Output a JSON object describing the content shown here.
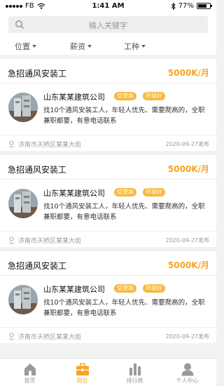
{
  "status_bar": {
    "carrier": "FB",
    "time": "1:41 AM",
    "battery": "77%",
    "battery_level": 0.77
  },
  "search": {
    "placeholder": "输入关键字"
  },
  "filters": [
    {
      "label": "位置"
    },
    {
      "label": "薪资"
    },
    {
      "label": "工种"
    }
  ],
  "jobs": [
    {
      "title": "急招通风安装工",
      "salary": "5000K/月",
      "company": "山东某某建筑公司",
      "tags": [
        "信誉高",
        "环境好"
      ],
      "description": "找10个通风安装工人，年轻人优先、需要爬高的，全职兼职都要，有意电话联系",
      "location": "济南市天桥区某某大街",
      "date": "2020-09-27发布"
    },
    {
      "title": "急招通风安装工",
      "salary": "5000K/月",
      "company": "山东某某建筑公司",
      "tags": [
        "信誉高",
        "环境好"
      ],
      "description": "找10个通风安装工人，年轻人优先、需要爬高的，全职兼职都要，有意电话联系",
      "location": "济南市天桥区某某大街",
      "date": "2020-09-27发布"
    },
    {
      "title": "急招通风安装工",
      "salary": "5000K/月",
      "company": "山东某某建筑公司",
      "tags": [
        "信誉高",
        "环境好"
      ],
      "description": "找10个通风安装工人，年轻人优先、需要爬高的，全职兼职都要，有意电话联系",
      "location": "济南市天桥区某某大街",
      "date": "2020-09-27发布"
    }
  ],
  "tabbar": [
    {
      "label": "首页",
      "icon": "home-icon",
      "active": false
    },
    {
      "label": "岗位",
      "icon": "briefcase-icon",
      "active": true
    },
    {
      "label": "排行榜",
      "icon": "bar-chart-icon",
      "active": false
    },
    {
      "label": "个人中心",
      "icon": "user-icon",
      "active": false
    }
  ],
  "colors": {
    "accent": "#f5a623",
    "tag_bg": "#f7b93a",
    "inactive": "#999999"
  }
}
